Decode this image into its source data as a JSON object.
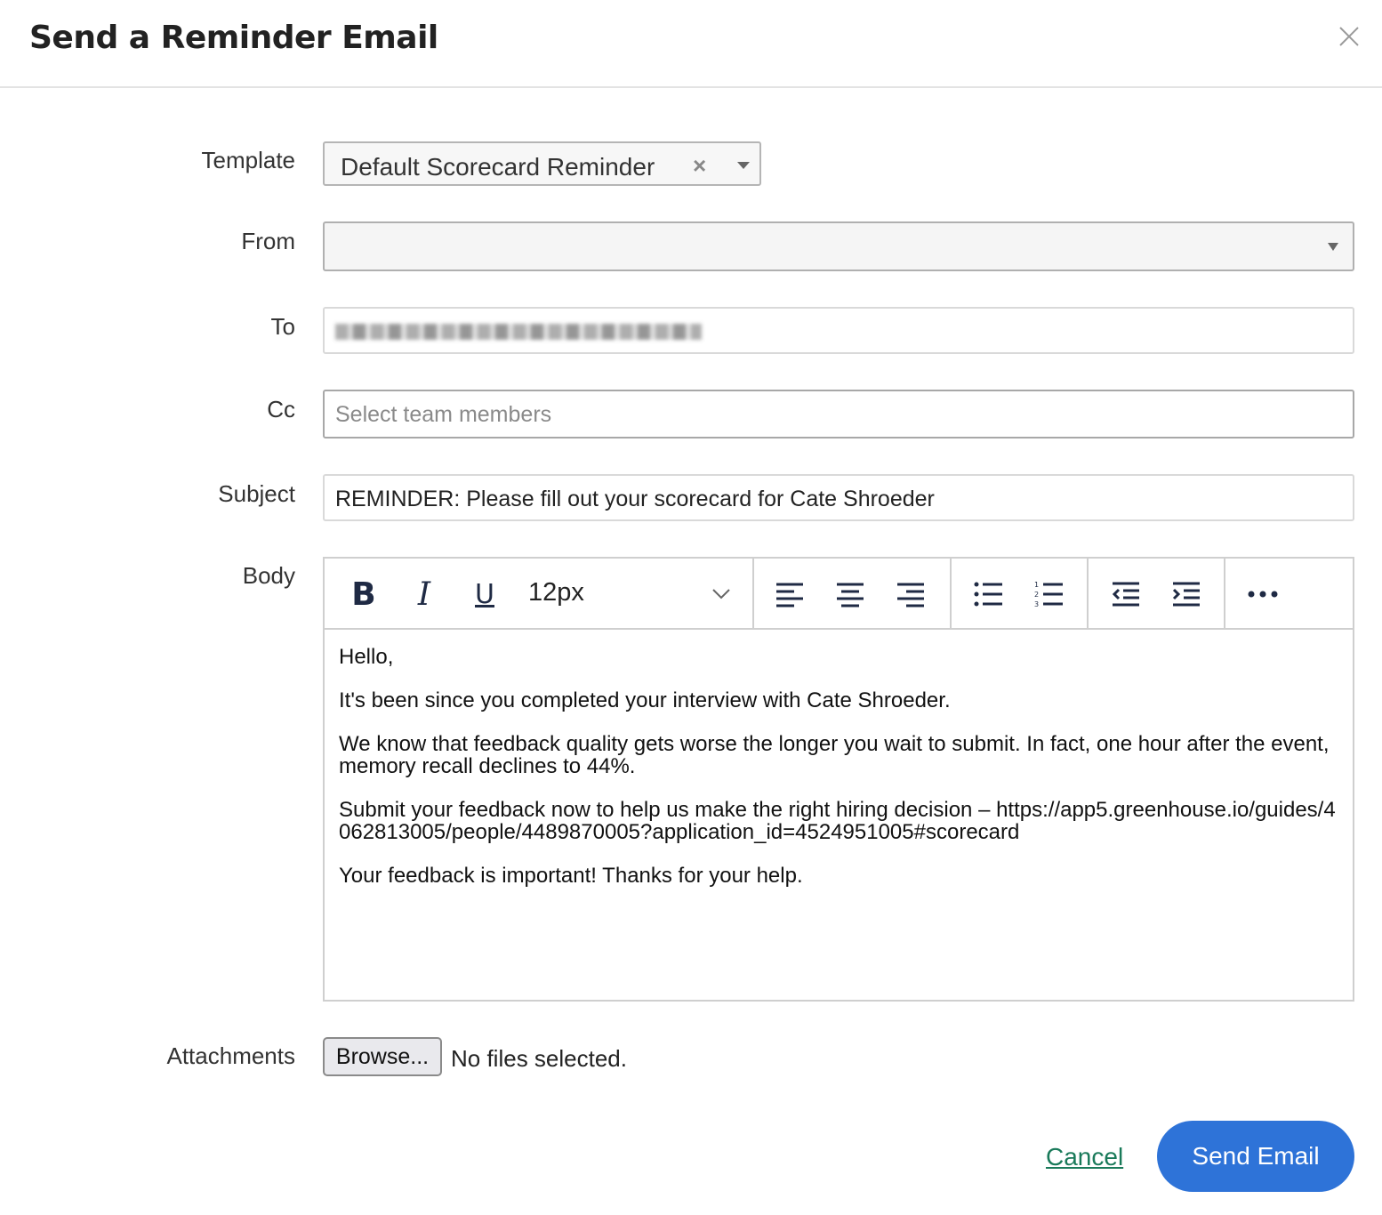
{
  "dialog": {
    "title": "Send a Reminder Email"
  },
  "labels": {
    "template": "Template",
    "from": "From",
    "to": "To",
    "cc": "Cc",
    "subject": "Subject",
    "body": "Body",
    "attachments": "Attachments"
  },
  "template_select": {
    "value": "Default Scorecard Reminder",
    "clear_glyph": "×"
  },
  "from_select": {
    "value": ""
  },
  "cc": {
    "placeholder": "Select team members"
  },
  "subject": {
    "value": "REMINDER: Please fill out your scorecard for Cate Shroeder"
  },
  "toolbar": {
    "bold": "B",
    "italic": "I",
    "underline": "U",
    "font_size": "12px",
    "icons": [
      "bold-icon",
      "italic-icon",
      "underline-icon",
      "chevron-down-icon",
      "align-left-icon",
      "align-center-icon",
      "align-right-icon",
      "bullet-list-icon",
      "numbered-list-icon",
      "outdent-icon",
      "indent-icon",
      "more-icon"
    ]
  },
  "body": {
    "paragraphs": [
      "Hello,",
      "It's been since you completed your interview with Cate Shroeder.",
      "We know that feedback quality gets worse the longer you wait to submit. In fact, one hour after the event, memory recall declines to 44%.",
      "Submit your feedback now to help us make the right hiring decision – https://app5.greenhouse.io/guides/4062813005/people/4489870005?application_id=4524951005#scorecard",
      "Your feedback is important! Thanks for your help."
    ]
  },
  "attachments": {
    "button_label": "Browse...",
    "status": "No files selected."
  },
  "actions": {
    "cancel": "Cancel",
    "send": "Send Email"
  },
  "colors": {
    "send_button": "#2e73d8",
    "cancel_link": "#1a7a5a"
  }
}
